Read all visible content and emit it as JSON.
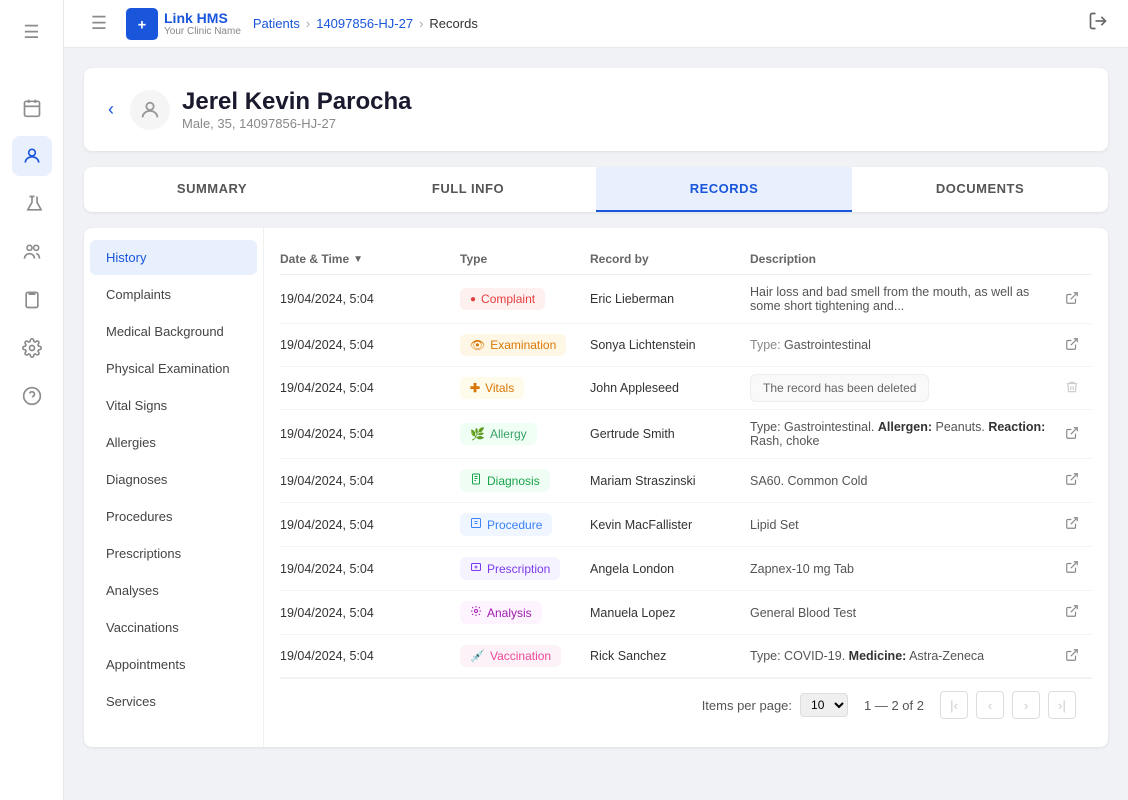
{
  "sidebar": {
    "icons": [
      {
        "name": "menu-icon",
        "symbol": "☰",
        "active": false
      },
      {
        "name": "calendar-icon",
        "symbol": "📅",
        "active": false
      },
      {
        "name": "patient-icon",
        "symbol": "👤",
        "active": true
      },
      {
        "name": "flask-icon",
        "symbol": "🧪",
        "active": false
      },
      {
        "name": "group-icon",
        "symbol": "👥",
        "active": false
      },
      {
        "name": "clipboard-icon",
        "symbol": "📋",
        "active": false
      },
      {
        "name": "settings-icon",
        "symbol": "⚙",
        "active": false
      },
      {
        "name": "help-icon",
        "symbol": "?",
        "active": false
      }
    ]
  },
  "topbar": {
    "menu_icon": "☰",
    "logo_text": "Link HMS",
    "logo_sub": "Your Clinic Name",
    "breadcrumbs": [
      "Patients",
      "14097856-HJ-27",
      "Records"
    ],
    "logout_icon": "⬚"
  },
  "patient": {
    "name": "Jerel Kevin Parocha",
    "details": "Male, 35, 14097856-HJ-27"
  },
  "tabs": [
    {
      "label": "SUMMARY",
      "active": false
    },
    {
      "label": "FULL INFO",
      "active": false
    },
    {
      "label": "RECORDS",
      "active": true
    },
    {
      "label": "DOCUMENTS",
      "active": false
    }
  ],
  "left_nav": {
    "items": [
      {
        "label": "History",
        "active": true
      },
      {
        "label": "Complaints",
        "active": false
      },
      {
        "label": "Medical Background",
        "active": false
      },
      {
        "label": "Physical Examination",
        "active": false
      },
      {
        "label": "Vital Signs",
        "active": false
      },
      {
        "label": "Allergies",
        "active": false
      },
      {
        "label": "Diagnoses",
        "active": false
      },
      {
        "label": "Procedures",
        "active": false
      },
      {
        "label": "Prescriptions",
        "active": false
      },
      {
        "label": "Analyses",
        "active": false
      },
      {
        "label": "Vaccinations",
        "active": false
      },
      {
        "label": "Appointments",
        "active": false
      },
      {
        "label": "Services",
        "active": false
      }
    ]
  },
  "table": {
    "columns": [
      "Date & Time",
      "Type",
      "Record by",
      "Description"
    ],
    "rows": [
      {
        "datetime": "19/04/2024, 5:04",
        "type": "Complaint",
        "badge_class": "badge-complaint",
        "badge_icon": "🔴",
        "record_by": "Eric Lieberman",
        "description": "Hair loss and bad smell from the mouth, as well as some short tightening and...",
        "description_html": false,
        "deleted": false
      },
      {
        "datetime": "19/04/2024, 5:04",
        "type": "Examination",
        "badge_class": "badge-examination",
        "badge_icon": "👁",
        "record_by": "Sonya Lichtenstein",
        "description": "Type: Gastrointestinal",
        "description_html": false,
        "deleted": false
      },
      {
        "datetime": "19/04/2024, 5:04",
        "type": "Vitals",
        "badge_class": "badge-vitals",
        "badge_icon": "➕",
        "record_by": "John Appleseed",
        "description": "",
        "description_html": false,
        "deleted": true,
        "deleted_msg": "The record has been deleted"
      },
      {
        "datetime": "19/04/2024, 5:04",
        "type": "Allergy",
        "badge_class": "badge-allergy",
        "badge_icon": "🌿",
        "record_by": "Gertrude Smith",
        "description": "Type: Gastrointestinal. Allergen: Peanuts. Reaction: Rash, choke",
        "description_html": true,
        "deleted": false
      },
      {
        "datetime": "19/04/2024, 5:04",
        "type": "Diagnosis",
        "badge_class": "badge-diagnosis",
        "badge_icon": "📋",
        "record_by": "Mariam Straszinski",
        "description": "SA60. Common Cold",
        "description_html": false,
        "deleted": false
      },
      {
        "datetime": "19/04/2024, 5:04",
        "type": "Procedure",
        "badge_class": "badge-procedure",
        "badge_icon": "📄",
        "record_by": "Kevin MacFallister",
        "description": "Lipid Set",
        "description_html": false,
        "deleted": false
      },
      {
        "datetime": "19/04/2024, 5:04",
        "type": "Prescription",
        "badge_class": "badge-prescription",
        "badge_icon": "💊",
        "record_by": "Angela London",
        "description": "Zapnex-10 mg Tab",
        "description_html": false,
        "deleted": false
      },
      {
        "datetime": "19/04/2024, 5:04",
        "type": "Analysis",
        "badge_class": "badge-analysis",
        "badge_icon": "🔬",
        "record_by": "Manuela Lopez",
        "description": "General Blood Test",
        "description_html": false,
        "deleted": false
      },
      {
        "datetime": "19/04/2024, 5:04",
        "type": "Vaccination",
        "badge_class": "badge-vaccination",
        "badge_icon": "💉",
        "record_by": "Rick Sanchez",
        "description": "Type: COVID-19. Medicine: Astra-Zeneca",
        "description_html": true,
        "deleted": false
      }
    ]
  },
  "pagination": {
    "items_per_page_label": "Items per page:",
    "items_per_page": "10",
    "range_text": "1 — 2 of 2"
  }
}
